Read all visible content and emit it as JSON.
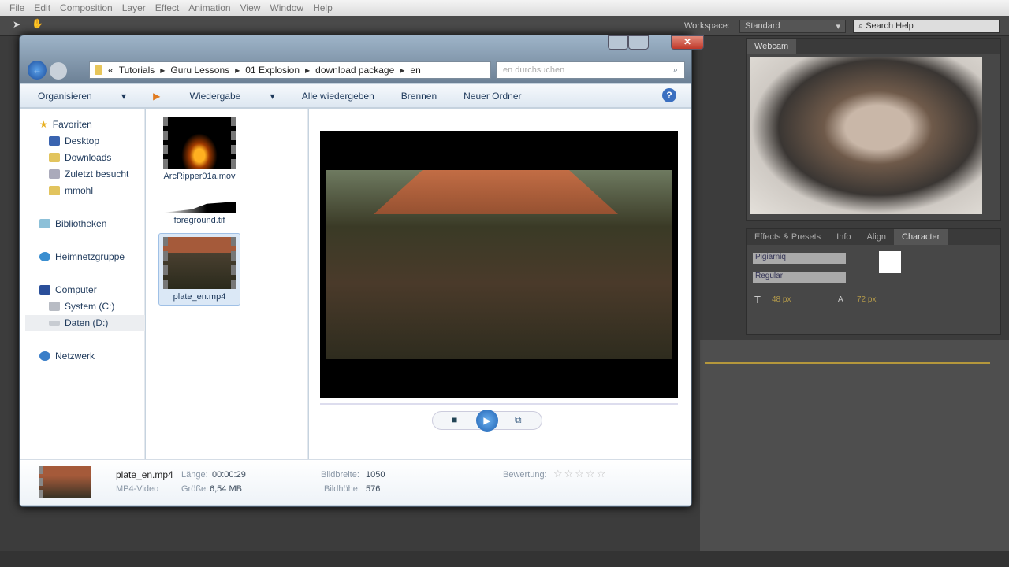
{
  "ae": {
    "menu": [
      "File",
      "Edit",
      "Composition",
      "Layer",
      "Effect",
      "Animation",
      "View",
      "Window",
      "Help"
    ],
    "workspace_label": "Workspace:",
    "workspace_value": "Standard",
    "search_help": "Search Help",
    "webcam_tab": "Webcam",
    "panel_tabs": [
      "Effects & Presets",
      "Info",
      "Align",
      "Character"
    ],
    "character": {
      "font": "Pigiarniq",
      "style": "Regular",
      "size": "48 px",
      "leading": "72 px"
    }
  },
  "explorer": {
    "breadcrumb": [
      "Tutorials",
      "Guru Lessons",
      "01 Explosion",
      "download package",
      "en"
    ],
    "search_placeholder": "en durchsuchen",
    "commands": [
      "Organisieren",
      "Wiedergabe",
      "Alle wiedergeben",
      "Brennen",
      "Neuer Ordner"
    ],
    "nav": {
      "favorites": "Favoriten",
      "fav_items": [
        "Desktop",
        "Downloads",
        "Zuletzt besucht",
        "mmohl"
      ],
      "libraries": "Bibliotheken",
      "homegroup": "Heimnetzgruppe",
      "computer": "Computer",
      "drives": [
        "System (C:)",
        "Daten (D:)"
      ],
      "network": "Netzwerk"
    },
    "files": [
      {
        "name": "ArcRipper01a.mov"
      },
      {
        "name": "foreground.tif"
      },
      {
        "name": "plate_en.mp4"
      }
    ],
    "details": {
      "name": "plate_en.mp4",
      "type": "MP4-Video",
      "length_label": "Länge:",
      "length": "00:00:29",
      "size_label": "Größe:",
      "size": "6,54 MB",
      "width_label": "Bildbreite:",
      "width": "1050",
      "height_label": "Bildhöhe:",
      "height": "576",
      "rating_label": "Bewertung:",
      "rating": 0
    }
  }
}
